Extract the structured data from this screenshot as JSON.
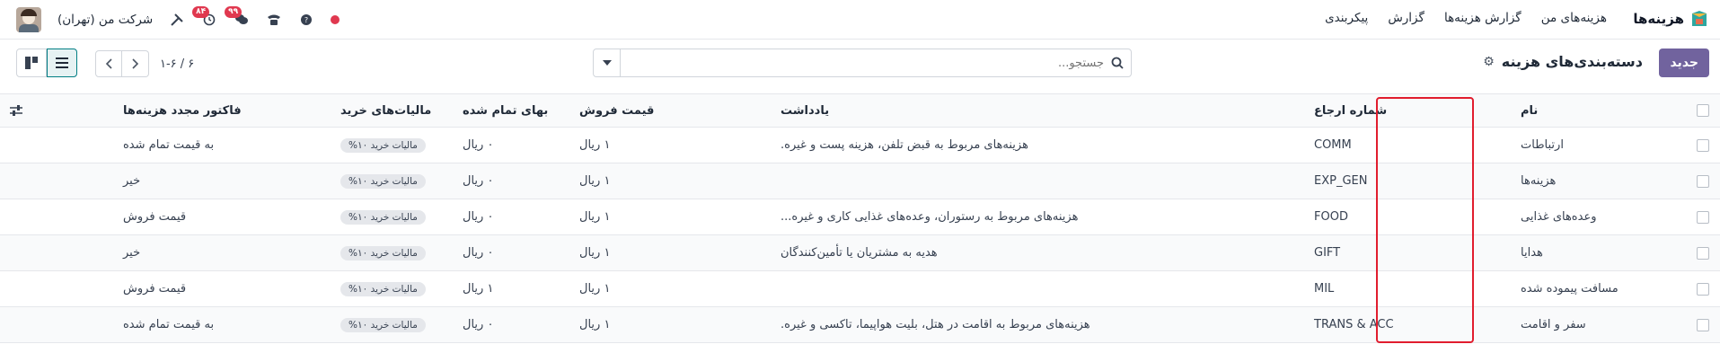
{
  "navbar": {
    "app_name": "هزینه‌ها",
    "menu": [
      "هزینه‌های من",
      "گزارش هزینه‌ها",
      "گزارش",
      "پیکربندی"
    ],
    "company": "شرکت من (تهران)",
    "activity_badge": "۸۴",
    "messages_badge": "۹۹"
  },
  "control": {
    "new_button": "جدید",
    "title": "دسته‌بندی‌های هزینه",
    "search_placeholder": "جستجو...",
    "pager_value": "۱-۶ / ۶"
  },
  "table": {
    "headers": {
      "name": "نام",
      "reference": "شماره ارجاع",
      "description": "یادداشت",
      "sales_price": "قیمت فروش",
      "cost": "بهای تمام شده",
      "purchase_taxes": "مالیات‌های خرید",
      "reinvoice": "فاکتور مجدد هزینه‌ها"
    },
    "rows": [
      {
        "name": "ارتباطات",
        "reference": "COMM",
        "description": "هزینه‌های مربوط به قبض تلفن، هزینه پست و غیره.",
        "sales_price": "۱ ریال",
        "cost": "۰ ریال",
        "tax": "مالیات خرید ۱۰%",
        "reinvoice": "به قیمت تمام شده"
      },
      {
        "name": "هزینه‌ها",
        "reference": "EXP_GEN",
        "description": "",
        "sales_price": "۱ ریال",
        "cost": "۰ ریال",
        "tax": "مالیات خرید ۱۰%",
        "reinvoice": "خیر"
      },
      {
        "name": "وعده‌های غذایی",
        "reference": "FOOD",
        "description": "هزینه‌های مربوط به رستوران، وعده‌های غذایی کاری و غیره...",
        "sales_price": "۱ ریال",
        "cost": "۰ ریال",
        "tax": "مالیات خرید ۱۰%",
        "reinvoice": "قیمت فروش"
      },
      {
        "name": "هدایا",
        "reference": "GIFT",
        "description": "هدیه به مشتریان یا تأمین‌کنندگان",
        "sales_price": "۱ ریال",
        "cost": "۰ ریال",
        "tax": "مالیات خرید ۱۰%",
        "reinvoice": "خیر"
      },
      {
        "name": "مسافت پیموده شده",
        "reference": "MIL",
        "description": "",
        "sales_price": "۱ ریال",
        "cost": "۱ ریال",
        "tax": "مالیات خرید ۱۰%",
        "reinvoice": "قیمت فروش"
      },
      {
        "name": "سفر و اقامت",
        "reference": "TRANS & ACC",
        "description": "هزینه‌های مربوط به اقامت در هتل، بلیت هواپیما، تاکسی و غیره.",
        "sales_price": "۱ ریال",
        "cost": "۰ ریال",
        "tax": "مالیات خرید ۱۰%",
        "reinvoice": "به قیمت تمام شده"
      }
    ]
  },
  "colors": {
    "primary": "#71639e",
    "notification": "#e0384f",
    "highlight": "#e11d2e",
    "active_view": "#017e84"
  },
  "icons": [
    "expenses-app-icon",
    "settings-gear-icon",
    "search-icon",
    "chevron-left-icon",
    "chevron-right-icon",
    "kanban-view-icon",
    "list-view-icon",
    "optional-columns-icon"
  ]
}
